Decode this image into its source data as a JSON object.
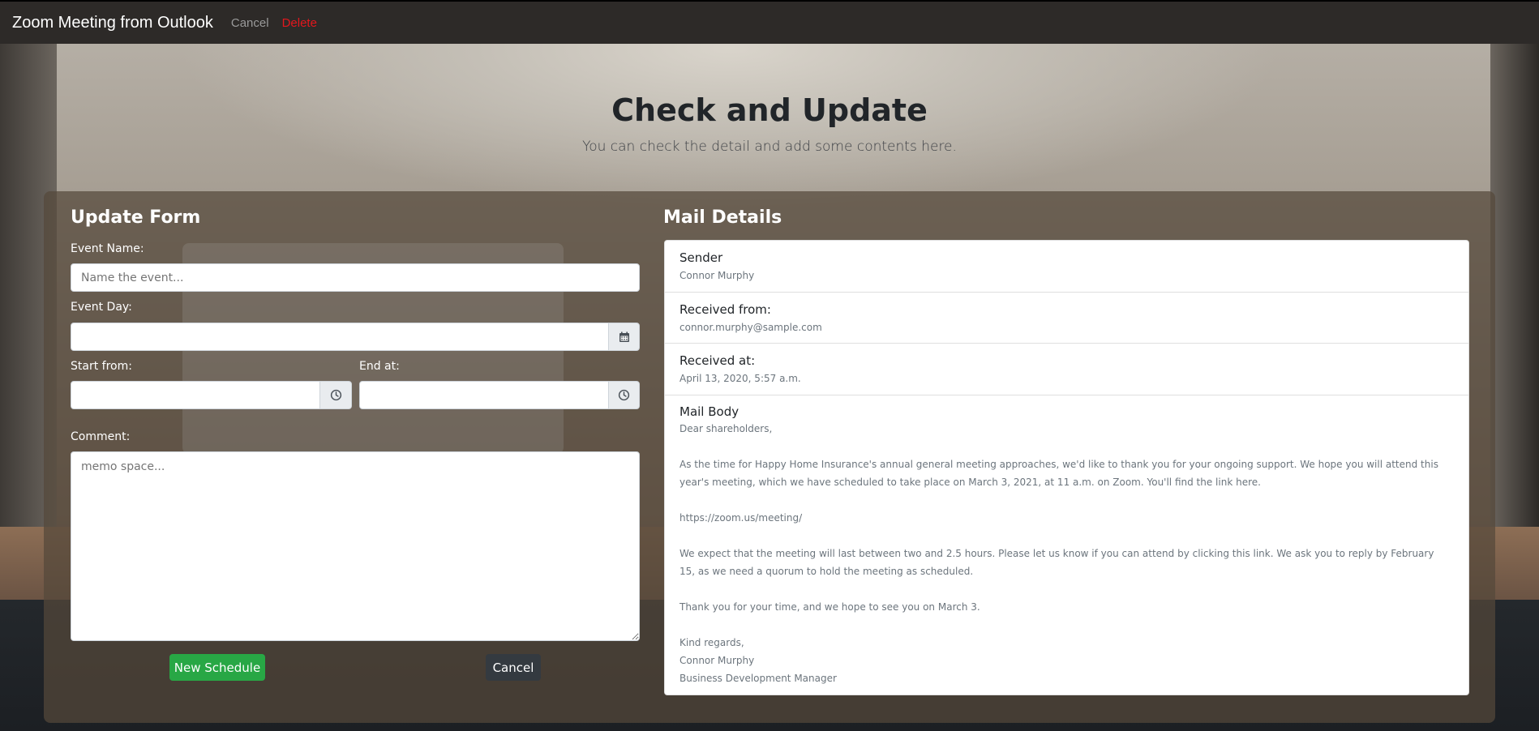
{
  "nav": {
    "brand": "Zoom Meeting from Outlook",
    "cancel": "Cancel",
    "delete": "Delete"
  },
  "hero": {
    "title": "Check and Update",
    "subtitle": "You can check the detail and add some contents here."
  },
  "form": {
    "title": "Update Form",
    "event_name_label": "Event Name:",
    "event_name_placeholder": "Name the event...",
    "event_name_value": "",
    "event_day_label": "Event Day:",
    "event_day_value": "",
    "start_label": "Start from:",
    "start_value": "",
    "end_label": "End at:",
    "end_value": "",
    "comment_label": "Comment:",
    "comment_placeholder": "memo space...",
    "submit_label": "New Schedule",
    "cancel_label": "Cancel",
    "icons": {
      "calendar": "calendar-icon",
      "clock": "clock-icon"
    }
  },
  "mail": {
    "title": "Mail Details",
    "sender_label": "Sender",
    "sender_value": "Connor Murphy",
    "received_from_label": "Received from:",
    "received_from_value": "connor.murphy@sample.com",
    "received_at_label": "Received at:",
    "received_at_value": "April 13, 2020, 5:57 a.m.",
    "body_label": "Mail Body",
    "body_lines": [
      "Dear shareholders,",
      "",
      "As the time for Happy Home Insurance's annual general meeting approaches, we'd like to thank you for your ongoing support. We hope you will attend this year's meeting, which we have scheduled to take place on March 3, 2021, at 11 a.m. on Zoom. You'll find the link here.",
      "",
      "https://zoom.us/meeting/",
      "",
      "We expect that the meeting will last between two and 2.5 hours. Please let us know if you can attend by clicking this link. We ask you to reply by February 15, as we need a quorum to hold the meeting as scheduled.",
      "",
      "Thank you for your time, and we hope to see you on March 3.",
      "",
      "Kind regards,",
      "Connor Murphy",
      "Business Development Manager"
    ]
  },
  "colors": {
    "navbar": "#2d2a28",
    "delete": "#e3171d",
    "success": "#28a745",
    "dark": "#343a40"
  }
}
